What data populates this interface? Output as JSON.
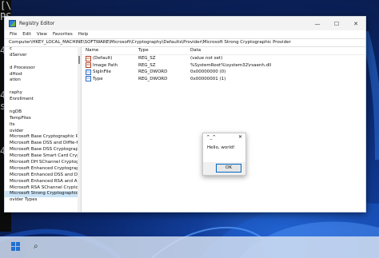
{
  "console": {
    "lines": [
      "[\\",
      "PS",
      "",
      "",
      "42>",
      "",
      "",
      "",
      "42>",
      "st",
      "",
      "",
      "",
      "42>",
      "",
      "",
      ""
    ]
  },
  "regedit": {
    "title": "Registry Editor",
    "window_controls": {
      "minimize": "—",
      "maximize": "☐",
      "close": "✕"
    },
    "menu": [
      "File",
      "Edit",
      "View",
      "Favorites",
      "Help"
    ],
    "address": "Computer\\HKEY_LOCAL_MACHINE\\SOFTWARE\\Microsoft\\Cryptography\\Defaults\\Provider\\Microsoft Strong Cryptographic Provider",
    "tree_items": [
      "c",
      "dServer",
      "",
      "d Processor",
      "dHost",
      "ation",
      "",
      "raphy",
      "Enrollment",
      "",
      "ngDB",
      "TempFiles",
      "lts",
      "ovider",
      "Microsoft Base Cryptographic Provid",
      "Microsoft Base DSS and Diffie-Hellm",
      "Microsoft Base DSS Cryptographic Pr",
      "Microsoft Base Smart Card Crypto Pr",
      "Microsoft DH SChannel Cryptograph",
      "Microsoft Enhanced Cryptographic P",
      "Microsoft Enhanced DSS and Diffie-",
      "Microsoft Enhanced RSA and AES Cr",
      "Microsoft RSA SChannel Cryptograp",
      "Microsoft Strong Cryptographic Prov",
      "ovider Types"
    ],
    "selected_index": 23,
    "columns": {
      "name": "Name",
      "type": "Type",
      "data": "Data"
    },
    "values": [
      {
        "icon": "ab",
        "name": "(Default)",
        "type": "REG_SZ",
        "data": "(value not set)"
      },
      {
        "icon": "ab",
        "name": "Image Path",
        "type": "REG_SZ",
        "data": "%SystemRoot%\\system32\\rsaenh.dll"
      },
      {
        "icon": "01",
        "name": "SigInFile",
        "type": "REG_DWORD",
        "data": "0x00000000 (0)"
      },
      {
        "icon": "01",
        "name": "Type",
        "type": "REG_DWORD",
        "data": "0x00000001 (1)"
      }
    ]
  },
  "dialog": {
    "title": "^_^",
    "close": "✕",
    "message": "Hello, world!",
    "ok_label": "OK"
  },
  "taskbar": {
    "start_icon": "windows-start-icon",
    "search_icon": "search-icon",
    "search_glyph": "⌕"
  }
}
